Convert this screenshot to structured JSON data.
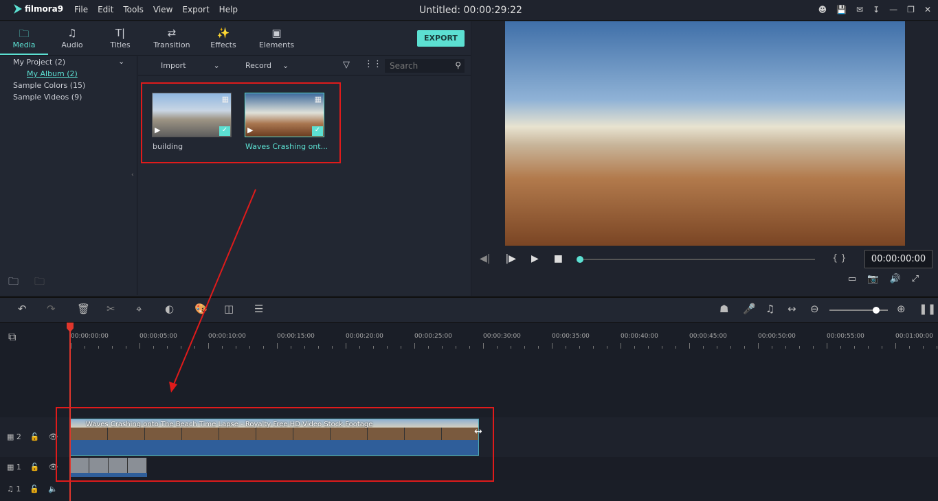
{
  "app": {
    "name": "filmora9",
    "menu": [
      "File",
      "Edit",
      "Tools",
      "View",
      "Export",
      "Help"
    ],
    "title": "Untitled:  00:00:29:22"
  },
  "tabs": [
    {
      "label": "Media",
      "icon": "folder-icon",
      "active": true
    },
    {
      "label": "Audio",
      "icon": "music-note-icon"
    },
    {
      "label": "Titles",
      "icon": "text-icon"
    },
    {
      "label": "Transition",
      "icon": "transition-icon"
    },
    {
      "label": "Effects",
      "icon": "effects-icon"
    },
    {
      "label": "Elements",
      "icon": "image-icon"
    }
  ],
  "export_label": "EXPORT",
  "sidebar": {
    "items": [
      "My Project (2)",
      "My Album (2)",
      "Sample Colors (15)",
      "Sample Videos (9)"
    ]
  },
  "media": {
    "import": "Import",
    "record": "Record",
    "search_placeholder": "Search",
    "items": [
      {
        "name": "building"
      },
      {
        "name": "Waves Crashing ont..."
      }
    ]
  },
  "preview": {
    "timecode": "00:00:00:00",
    "progress": 0
  },
  "timeline": {
    "ruler": [
      "00:00:00:00",
      "00:00:05:00",
      "00:00:10:00",
      "00:00:15:00",
      "00:00:20:00",
      "00:00:25:00",
      "00:00:30:00",
      "00:00:35:00",
      "00:00:40:00",
      "00:00:45:00",
      "00:00:50:00",
      "00:00:55:00",
      "00:01:00:00"
    ],
    "tracks": [
      {
        "label": "2",
        "type": "video"
      },
      {
        "label": "1",
        "type": "video"
      },
      {
        "label": "1",
        "type": "audio"
      }
    ],
    "clip_title": "Waves Crashing onto The Beach Time Lapse - Royalty Free HD Video Stock Footage",
    "zoom_level": 0.8
  },
  "colors": {
    "accent": "#5ce0d2",
    "annotation": "#e01b1b",
    "playhead": "#e0362c"
  }
}
